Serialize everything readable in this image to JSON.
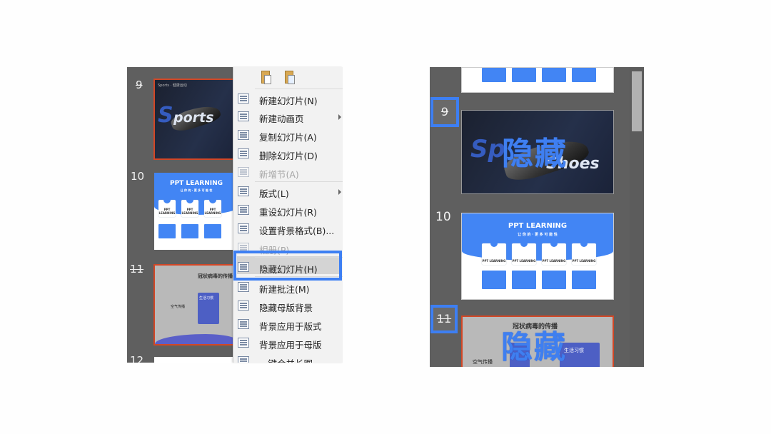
{
  "left_panel": {
    "slide_numbers": [
      "9",
      "10",
      "11",
      "12"
    ],
    "slide9": {
      "text1": "S",
      "text2": "ports",
      "caption": "Sports · 健康运动"
    },
    "slide10": {
      "title": "PPT LEARNING",
      "subtitle": "让 你 的 · 更 多 可 能 性",
      "card_label": "PPT LEARNING"
    },
    "slide11": {
      "title": "冠状病毒的传播",
      "box_label": "生活习惯",
      "side_label": "空气传播"
    }
  },
  "context_menu": {
    "items": [
      {
        "label": "新建幻灯片(N)",
        "disabled": false,
        "submenu": false
      },
      {
        "label": "新建动画页",
        "disabled": false,
        "submenu": true
      },
      {
        "label": "复制幻灯片(A)",
        "disabled": false,
        "submenu": false
      },
      {
        "label": "删除幻灯片(D)",
        "disabled": false,
        "submenu": false
      },
      {
        "label": "新增节(A)",
        "disabled": true,
        "submenu": false
      },
      {
        "label": "版式(L)",
        "disabled": false,
        "submenu": true
      },
      {
        "label": "重设幻灯片(R)",
        "disabled": false,
        "submenu": false
      },
      {
        "label": "设置背景格式(B)...",
        "disabled": false,
        "submenu": false
      },
      {
        "label": "相册(P)...",
        "disabled": true,
        "submenu": false
      },
      {
        "label": "隐藏幻灯片(H)",
        "disabled": false,
        "submenu": false,
        "highlighted": true
      },
      {
        "label": "新建批注(M)",
        "disabled": false,
        "submenu": false
      },
      {
        "label": "隐藏母版背景",
        "disabled": false,
        "submenu": false
      },
      {
        "label": "背景应用于版式",
        "disabled": false,
        "submenu": false
      },
      {
        "label": "背景应用于母版",
        "disabled": false,
        "submenu": false
      },
      {
        "label": "一键合并长图",
        "disabled": false,
        "submenu": false
      }
    ]
  },
  "right_panel": {
    "slide_numbers": [
      "9",
      "10",
      "11"
    ],
    "slide9": {
      "text1": "Sp",
      "text2": "Shoes",
      "overlay": "隐藏"
    },
    "slide10": {
      "title": "PPT LEARNING",
      "subtitle": "让 你 的 · 更 多 可 能 性",
      "card_label": "PPT LEARNING"
    },
    "slide11": {
      "title": "冠状病毒的传播",
      "overlay": "隐藏",
      "box_label": "生活习惯",
      "side_label": "空气传播"
    }
  },
  "colors": {
    "accent": "#3d7ff3",
    "slide_blue": "#4285f4",
    "selected_border": "#d24726",
    "panel_bg": "#5f5f5f"
  }
}
